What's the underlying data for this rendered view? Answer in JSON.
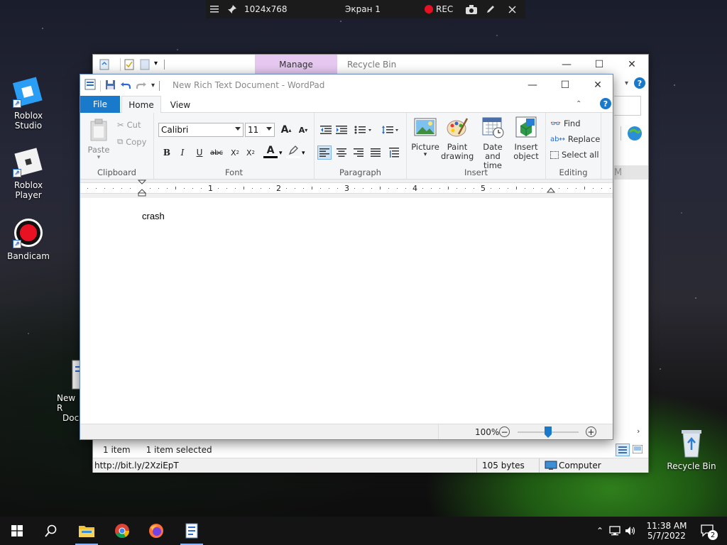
{
  "recording_bar": {
    "resolution": "1024x768",
    "screen": "Экран 1",
    "rec_label": "REC"
  },
  "desktop": {
    "icons": [
      {
        "label": "Roblox Studio"
      },
      {
        "label": "Roblox Player"
      },
      {
        "label": "Bandicam"
      },
      {
        "label_line1": "New R",
        "label_line2": "Doc"
      },
      {
        "label": "Recycle Bin"
      }
    ]
  },
  "explorer": {
    "manage_tab": "Manage",
    "title": "Recycle Bin",
    "partial_column": "M",
    "status": {
      "items": "1 item",
      "selected": "1 item selected"
    },
    "details_bar": {
      "link": "http://bit.ly/2XziEpT",
      "size": "105 bytes",
      "location": "Computer"
    }
  },
  "wordpad": {
    "title": "New Rich Text Document - WordPad",
    "tabs": {
      "file": "File",
      "home": "Home",
      "view": "View"
    },
    "clipboard": {
      "paste": "Paste",
      "cut": "Cut",
      "copy": "Copy",
      "label": "Clipboard"
    },
    "font": {
      "family": "Calibri",
      "size": "11",
      "label": "Font"
    },
    "paragraph": {
      "label": "Paragraph"
    },
    "insert": {
      "picture": "Picture",
      "paint_line1": "Paint",
      "paint_line2": "drawing",
      "datetime_line1": "Date and",
      "datetime_line2": "time",
      "object_line1": "Insert",
      "object_line2": "object",
      "label": "Insert"
    },
    "editing": {
      "find": "Find",
      "replace": "Replace",
      "select_all": "Select all",
      "label": "Editing"
    },
    "ruler_numbers": [
      "1",
      "2",
      "3",
      "4",
      "5"
    ],
    "document_text": "crash",
    "zoom": "100%"
  },
  "taskbar": {
    "time": "11:38 AM",
    "date": "5/7/2022",
    "notifications": "2"
  }
}
